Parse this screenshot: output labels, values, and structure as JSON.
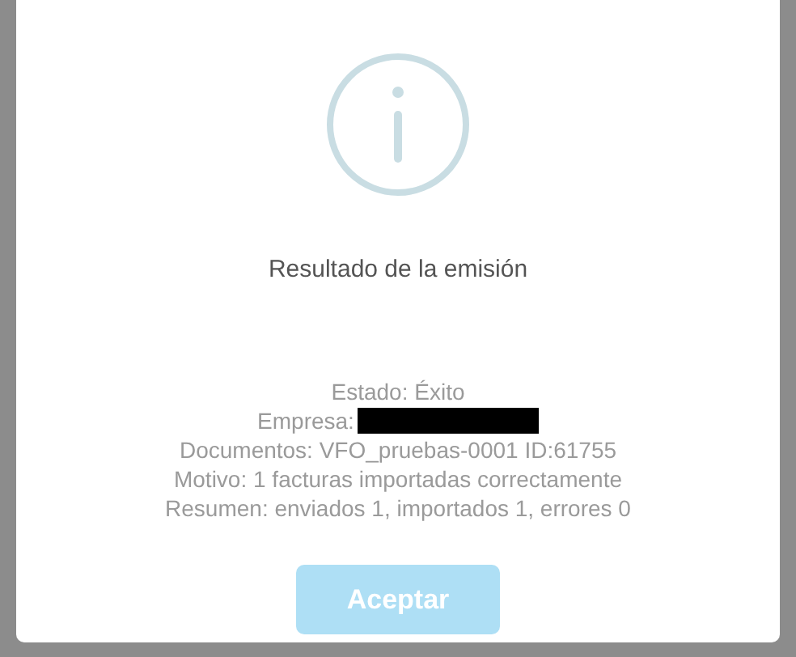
{
  "dialog": {
    "title": "Resultado de la emisión",
    "details": [
      {
        "text": "Estado: Éxito",
        "redacted": false
      },
      {
        "text": "Empresa:",
        "redacted": true
      },
      {
        "text": "Documentos: VFO_pruebas-0001 ID:61755",
        "redacted": false
      },
      {
        "text": "Motivo: 1 facturas importadas correctamente",
        "redacted": false
      },
      {
        "text": "Resumen: enviados 1, importados 1, errores 0",
        "redacted": false
      }
    ],
    "button": "Aceptar"
  }
}
